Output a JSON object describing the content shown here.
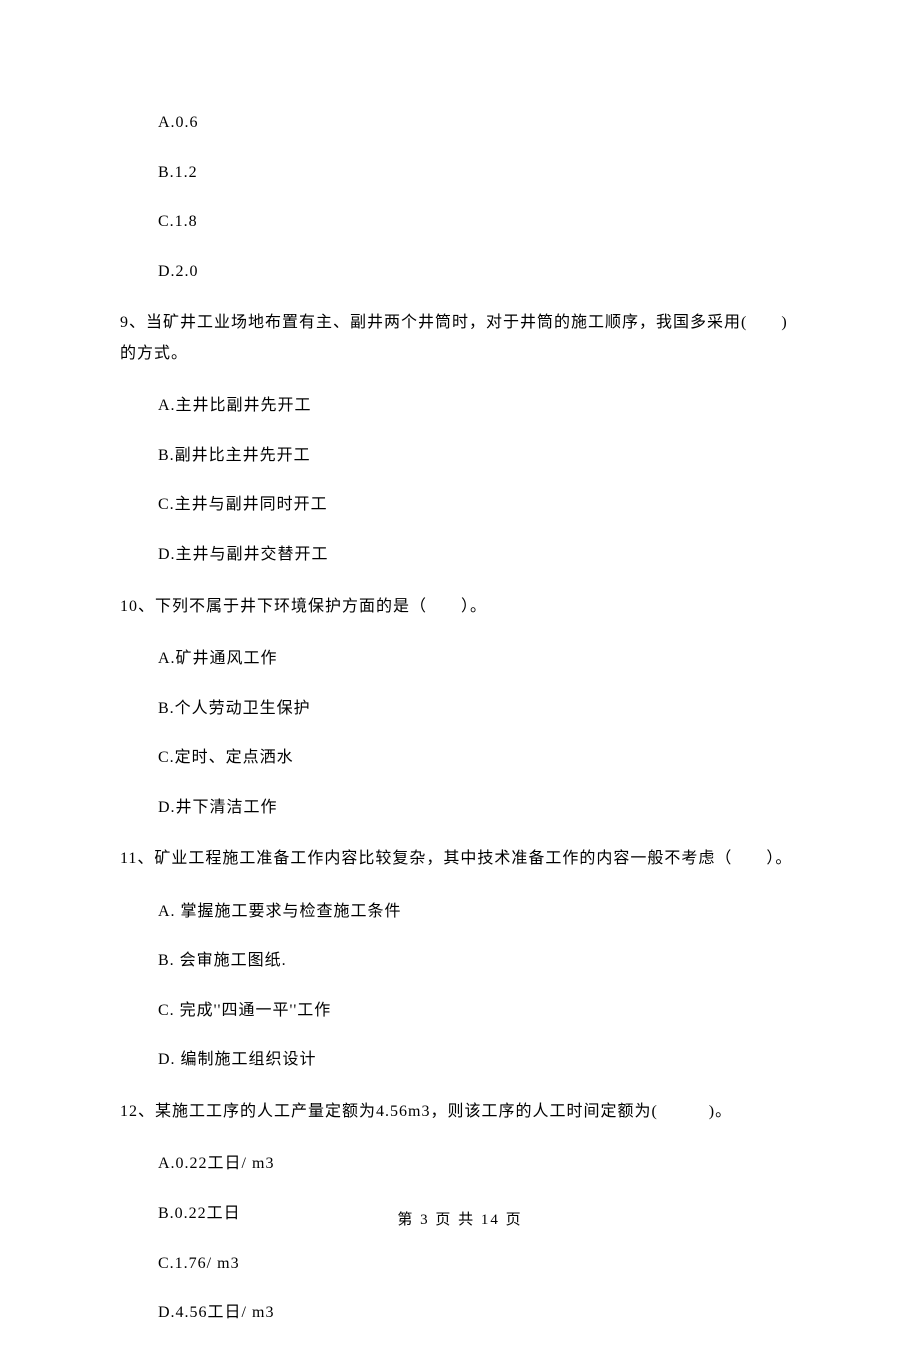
{
  "q8_options": {
    "a": "A.0.6",
    "b": "B.1.2",
    "c": "C.1.8",
    "d": "D.2.0"
  },
  "q9": {
    "stem": "9、当矿井工业场地布置有主、副井两个井筒时，对于井筒的施工顺序，我国多采用(　　)的方式。",
    "a": "A.主井比副井先开工",
    "b": "B.副井比主井先开工",
    "c": "C.主井与副井同时开工",
    "d": "D.主井与副井交替开工"
  },
  "q10": {
    "stem": "10、下列不属于井下环境保护方面的是（　　）。",
    "a": "A.矿井通风工作",
    "b": "B.个人劳动卫生保护",
    "c": "C.定时、定点洒水",
    "d": "D.井下清洁工作"
  },
  "q11": {
    "stem": "11、矿业工程施工准备工作内容比较复杂，其中技术准备工作的内容一般不考虑（　　）。",
    "a": "A. 掌握施工要求与检查施工条件",
    "b": "B. 会审施工图纸.",
    "c": "C. 完成''四通一平''工作",
    "d": "D. 编制施工组织设计"
  },
  "q12": {
    "stem": "12、某施工工序的人工产量定额为4.56m3，则该工序的人工时间定额为(　　　)。",
    "a": "A.0.22工日/ m3",
    "b": "B.0.22工日",
    "c": "C.1.76/ m3",
    "d": "D.4.56工日/ m3"
  },
  "footer": "第 3 页 共 14 页"
}
